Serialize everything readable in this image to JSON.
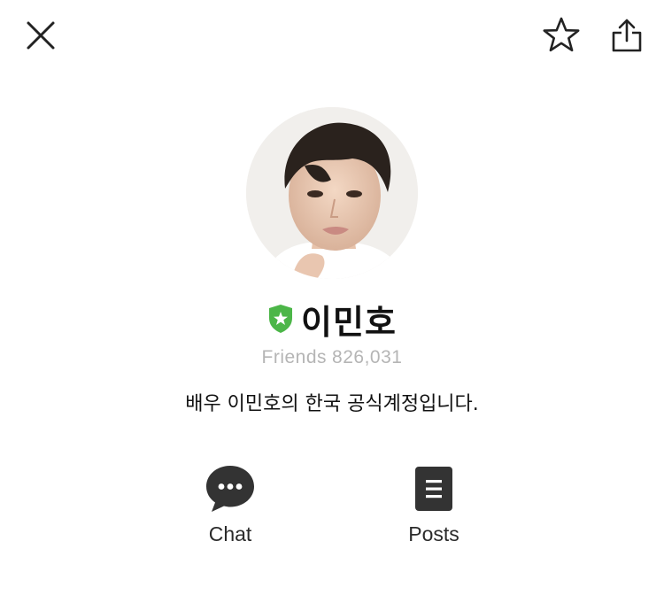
{
  "header": {
    "close_icon": "close-icon",
    "favorite_icon": "star-icon",
    "share_icon": "share-icon"
  },
  "profile": {
    "name": "이민호",
    "badge_icon": "official-shield-icon",
    "badge_color": "#4cb648",
    "friends_label": "Friends",
    "friends_count": "826,031",
    "description": "배우 이민호의 한국 공식계정입니다."
  },
  "actions": [
    {
      "label": "Chat",
      "icon": "chat-bubble-icon"
    },
    {
      "label": "Posts",
      "icon": "posts-icon"
    }
  ],
  "colors": {
    "icon_dark": "#333333",
    "friends_text": "#b5b5b5",
    "background": "#ffffff"
  }
}
